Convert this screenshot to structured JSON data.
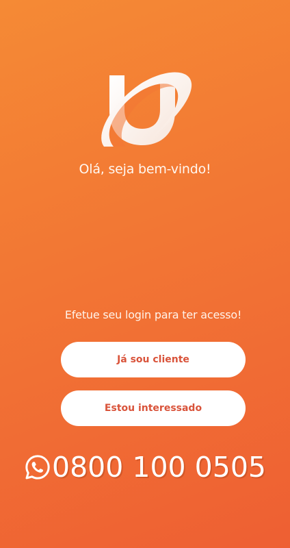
{
  "brand": {
    "logo_icon": "brand-u-orbit-logo"
  },
  "welcome": {
    "greeting": "Olá, seja bem-vindo!"
  },
  "login": {
    "prompt": "Efetue seu login para ter acesso!",
    "client_button_label": "Já sou cliente",
    "interested_button_label": "Estou interessado"
  },
  "contact": {
    "icon": "whatsapp-icon",
    "phone": "0800 100 0505"
  },
  "colors": {
    "gradient_start": "#f58a35",
    "gradient_end": "#ee5f33",
    "button_background": "#ffffff",
    "button_text": "#d9533a"
  }
}
